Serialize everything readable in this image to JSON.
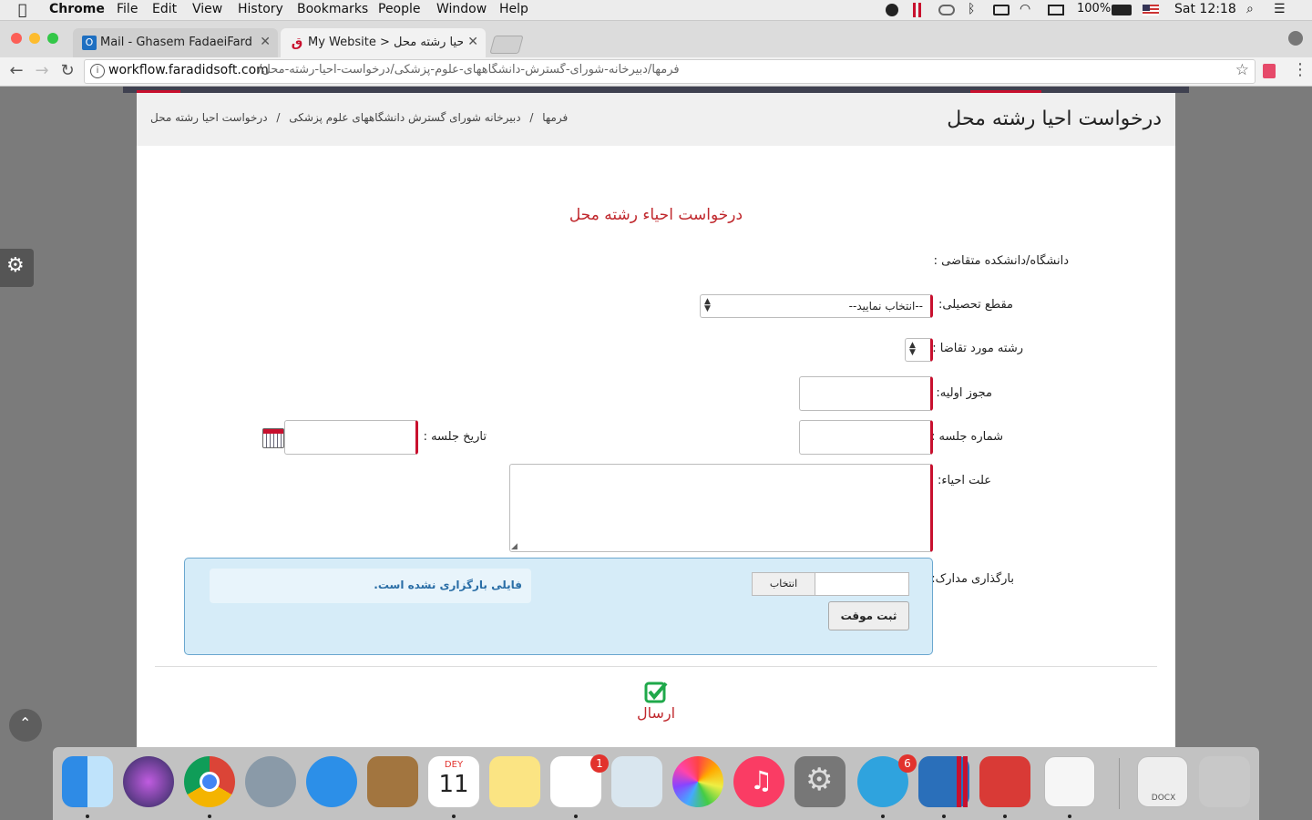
{
  "menubar": {
    "app": "Chrome",
    "items": [
      "File",
      "Edit",
      "View",
      "History",
      "Bookmarks",
      "People",
      "Window",
      "Help"
    ],
    "battery": "100%",
    "clock": "Sat 12:18"
  },
  "browser": {
    "tabs": [
      {
        "label": "Mail - Ghasem FadaeiFard - O",
        "icon": "outlook-icon"
      },
      {
        "label": "My Website > درخواست احیا رشته محل",
        "icon": "website-icon"
      }
    ],
    "url_host": "workflow.faradidsoft.com",
    "url_path": "/فرمها/دبیرخانه-شورای-گسترش-دانشگاههای-علوم-پزشکی/درخواست-احیا-رشته-محل"
  },
  "page": {
    "heading": "درخواست احیا رشته محل",
    "breadcrumb": [
      "فرمها",
      "دبیرخانه شورای گسترش دانشگاههای علوم پزشکی",
      "درخواست احیا رشته محل"
    ],
    "form_title": "درخواست احیاء رشته محل",
    "labels": {
      "university": "دانشگاه/دانشکده متقاضی :",
      "grade": "مقطع تحصیلی:",
      "field": "رشته مورد تقاضا :",
      "license": "مجوز اولیه:",
      "session_no": "شماره جلسه :",
      "session_date": "تاریخ جلسه :",
      "reason": "علت احیاء:",
      "upload": "بارگذاری مدارک:"
    },
    "grade_select_value": "--انتخاب نمایید--",
    "upload": {
      "choose_label": "انتخاب",
      "status": "فایلی بارگزاری نشده است.",
      "save_temp_label": "ثبت موقت"
    },
    "submit_label": "ارسال"
  },
  "dock": {
    "calendar_month": "DEY",
    "calendar_day": "11",
    "reminders_badge": "1",
    "telegram_badge": "6",
    "docx_label": "DOCX"
  },
  "colors": {
    "required_accent": "#c8102e",
    "form_title": "#c0282d",
    "submit_green": "#1fa84a",
    "upload_panel_bg": "#d6ecf8",
    "upload_panel_border": "#6aa7cf"
  }
}
